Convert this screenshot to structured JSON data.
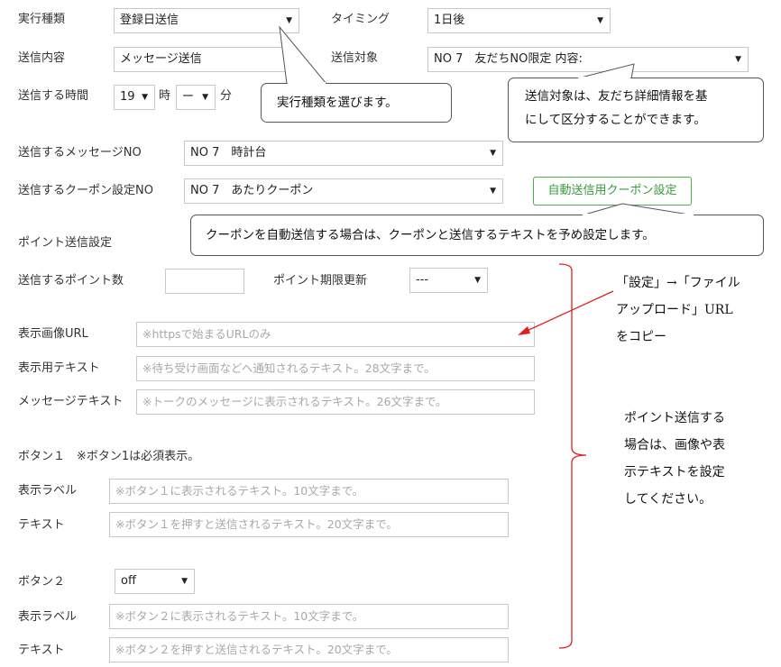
{
  "form": {
    "exec_type": {
      "label": "実行種類",
      "value": "登録日送信"
    },
    "timing": {
      "label": "タイミング",
      "value": "1日後"
    },
    "send_content": {
      "label": "送信内容",
      "value": "メッセージ送信"
    },
    "send_target": {
      "label": "送信対象",
      "value": "NO 7　友だちNO限定 内容:"
    },
    "send_time": {
      "label": "送信する時間",
      "hour": "19",
      "hour_unit": "時",
      "minute": "ー",
      "minute_unit": "分"
    },
    "message_no": {
      "label": "送信するメッセージNO",
      "value": "NO 7　時計台"
    },
    "coupon_no": {
      "label": "送信するクーポン設定NO",
      "value": "NO 7　あたりクーポン"
    },
    "coupon_button": "自動送信用クーポン設定",
    "point_section": "ポイント送信設定",
    "point_count": {
      "label": "送信するポイント数",
      "value": ""
    },
    "point_expiry": {
      "label": "ポイント期限更新",
      "value": "---"
    },
    "image_url": {
      "label": "表示画像URL",
      "placeholder": "※httpsで始まるURLのみ"
    },
    "display_text": {
      "label": "表示用テキスト",
      "placeholder": "※待ち受け画面などへ通知されるテキスト。28文字まで。"
    },
    "message_text": {
      "label": "メッセージテキスト",
      "placeholder": "※トークのメッセージに表示されるテキスト。26文字まで。"
    },
    "button1": {
      "heading": "ボタン１　※ボタン1は必須表示。",
      "label_label": "表示ラベル",
      "label_placeholder": "※ボタン１に表示されるテキスト。10文字まで。",
      "text_label": "テキスト",
      "text_placeholder": "※ボタン１を押すと送信されるテキスト。20文字まで。"
    },
    "button2": {
      "heading": "ボタン２",
      "select_value": "off",
      "label_label": "表示ラベル",
      "label_placeholder": "※ボタン２に表示されるテキスト。10文字まで。",
      "text_label": "テキスト",
      "text_placeholder": "※ボタン２を押すと送信されるテキスト。20文字まで。"
    }
  },
  "annotations": {
    "exec_type_callout": "実行種類を選びます。",
    "target_callout_line1": "送信対象は、友だち詳細情報を基",
    "target_callout_line2": "にして区分することができます。",
    "coupon_callout": "クーポンを自動送信する場合は、クーポンと送信するテキストを予め設定します。",
    "url_note": [
      "「設定」→「ファイル",
      "アップロード」URL",
      "をコピー"
    ],
    "point_note": [
      "ポイント送信する",
      "場合は、画像や表",
      "示テキストを設定",
      "してください。"
    ]
  },
  "colors": {
    "accent_green": "#4cae4c",
    "arrow_red": "#e02020",
    "bracket_red": "#e02020"
  }
}
